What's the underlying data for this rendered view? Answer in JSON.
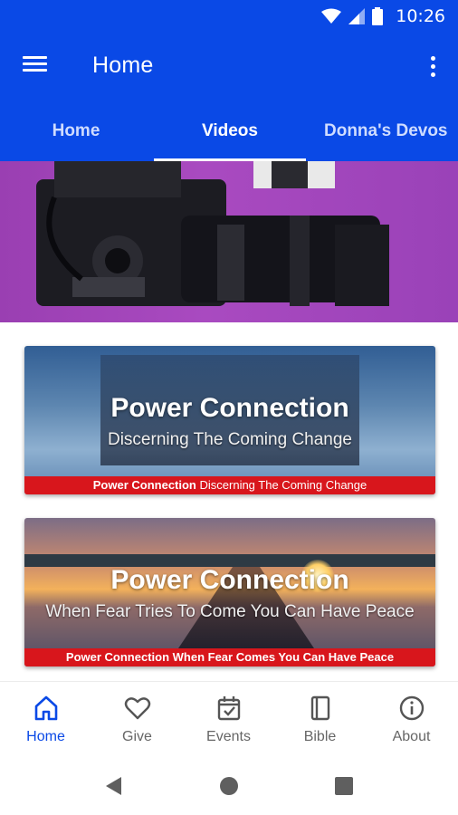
{
  "status_bar": {
    "time": "10:26"
  },
  "app_bar": {
    "title": "Home"
  },
  "tabs": [
    {
      "label": "Home",
      "active": false
    },
    {
      "label": "Videos",
      "active": true
    },
    {
      "label": "Donna's Devos",
      "active": false
    }
  ],
  "cards": [
    {
      "title": "Power Connection",
      "subtitle": "Discerning The Coming Change",
      "banner_bold": "Power Connection",
      "banner_rest": "Discerning The Coming Change"
    },
    {
      "title": "Power Connection",
      "subtitle": "When Fear Tries To Come You Can Have Peace",
      "banner": "Power Connection When Fear Comes You Can Have Peace"
    }
  ],
  "bottom_nav": [
    {
      "label": "Home",
      "icon": "home-icon",
      "active": true
    },
    {
      "label": "Give",
      "icon": "heart-icon",
      "active": false
    },
    {
      "label": "Events",
      "icon": "calendar-check-icon",
      "active": false
    },
    {
      "label": "Bible",
      "icon": "book-icon",
      "active": false
    },
    {
      "label": "About",
      "icon": "info-icon",
      "active": false
    }
  ],
  "colors": {
    "primary": "#0a49e6",
    "banner_red": "#d8161c",
    "hero_purple": "#a94ac0",
    "nav_inactive": "#666666"
  }
}
